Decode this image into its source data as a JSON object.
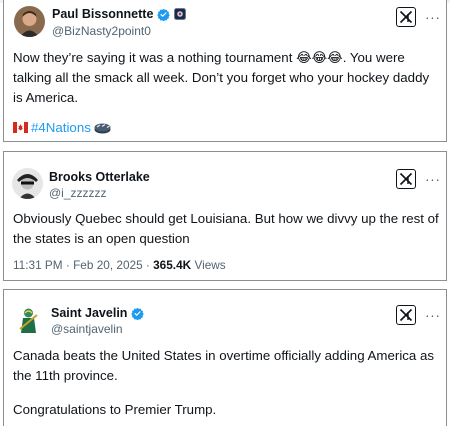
{
  "tweets": [
    {
      "name": "Paul Bissonnette",
      "handle": "@BizNasty2point0",
      "verified": true,
      "text": "Now they’re saying it was a nothing tournament 😂😂😂. You were talking all the smack all week. Don’t you forget who your hockey daddy is America.",
      "hashtag": "#4Nations"
    },
    {
      "name": "Brooks Otterlake",
      "handle": "@i_zzzzzz",
      "verified": false,
      "text": "Obviously Quebec should get Louisiana. But how we divvy up the rest of the states is an open question",
      "timestamp": "11:31 PM · Feb 20, 2025 · ",
      "views": "365.4K",
      "views_label": " Views"
    },
    {
      "name": "Saint Javelin",
      "handle": "@saintjavelin",
      "verified": true,
      "text": "Canada beats the United States in overtime officially adding America as the 11th province.",
      "text2": "Congratulations to Premier Trump."
    }
  ],
  "colors": {
    "verified": "#1d9bf0",
    "hashtag": "#1d9bf0",
    "secondary_text": "#536471",
    "primary_text": "#0f1419"
  },
  "icons": {
    "verified": "verified-badge-icon",
    "x_logo": "x-logo-icon",
    "more": "more-options-icon",
    "flag": "canada-flag-icon",
    "hockey": "hockey-emoji-icon",
    "badge": "square-badge-icon"
  }
}
